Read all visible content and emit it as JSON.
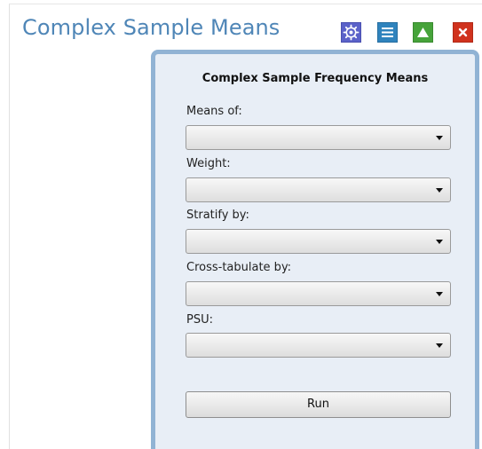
{
  "window": {
    "title": "Complex Sample Means"
  },
  "toolbar": {
    "icons": [
      "gear-icon",
      "list-icon",
      "triangle-up-icon",
      "close-icon"
    ],
    "colors": {
      "settings": "#5b62c9",
      "list": "#2f83bd",
      "up": "#46a33a",
      "close": "#d0321d"
    }
  },
  "panel": {
    "title": "Complex Sample Frequency Means",
    "fields": [
      {
        "label": "Means of:",
        "value": ""
      },
      {
        "label": "Weight:",
        "value": ""
      },
      {
        "label": "Stratify by:",
        "value": ""
      },
      {
        "label": "Cross-tabulate by:",
        "value": ""
      },
      {
        "label": "PSU:",
        "value": ""
      }
    ],
    "run_label": "Run"
  },
  "colors": {
    "title_text": "#4f86b7",
    "panel_bg": "#e8eef6",
    "panel_border": "#91b3d4"
  }
}
